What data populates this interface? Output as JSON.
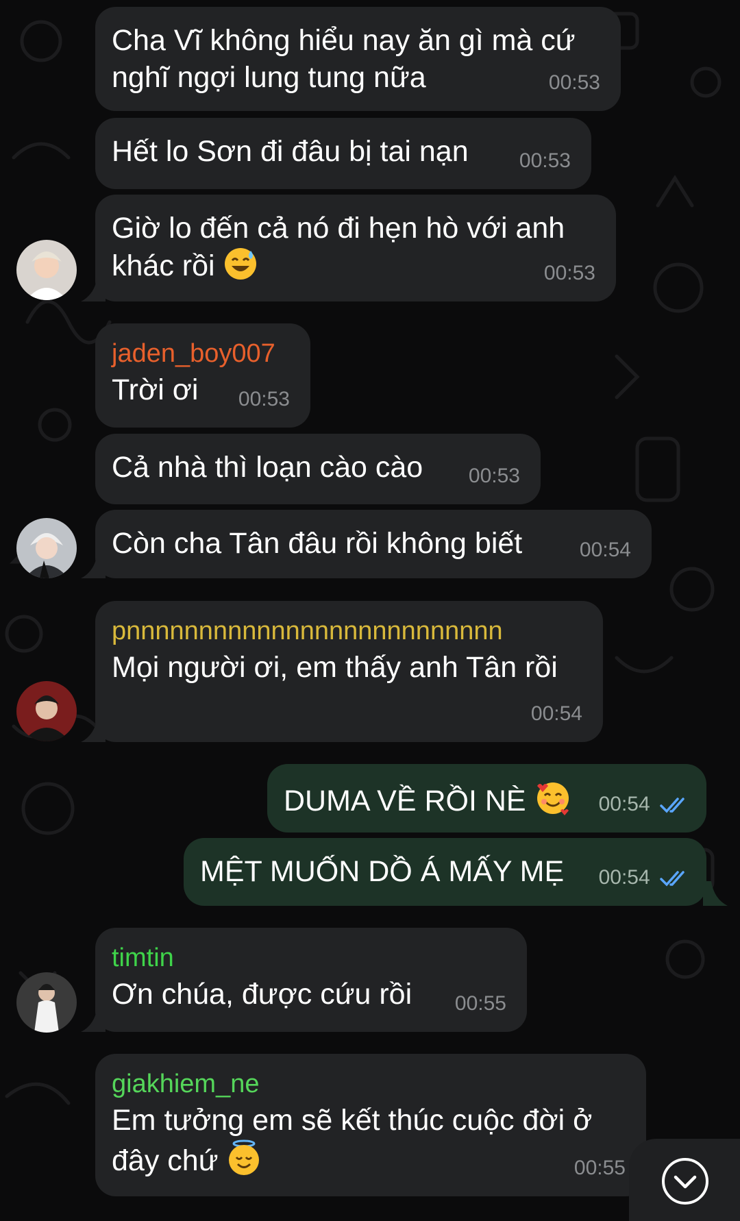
{
  "messages": [
    {
      "id": "m1",
      "direction": "incoming",
      "sender": "",
      "text": "Cha Vĩ không hiểu nay ăn gì mà cứ\nnghĩ ngợi lung tung nữa",
      "time": "00:53"
    },
    {
      "id": "m2",
      "direction": "incoming",
      "sender": "",
      "text": "Hết lo Sơn đi đâu bị tai nạn",
      "time": "00:53"
    },
    {
      "id": "m3",
      "direction": "incoming",
      "sender": "",
      "text": "Giờ lo đến cả nó đi hẹn hò với anh\nkhác rồi",
      "emoji": "sweat-smile-emoji",
      "time": "00:53"
    },
    {
      "id": "m4",
      "direction": "incoming",
      "sender": "jaden_boy007",
      "sender_color": "#e8602c",
      "text": "Trời ơi",
      "time": "00:53"
    },
    {
      "id": "m5",
      "direction": "incoming",
      "sender": "",
      "text": "Cả nhà thì loạn cào cào",
      "time": "00:53"
    },
    {
      "id": "m6",
      "direction": "incoming",
      "sender": "",
      "text": "Còn cha Tân đâu rồi không biết",
      "time": "00:54"
    },
    {
      "id": "m7",
      "direction": "incoming",
      "sender": "pnnnnnnnnnnnnnnnnnnnnnnnnnn",
      "sender_color": "#d9b93b",
      "text": "Mọi người ơi, em thấy anh Tân rồi",
      "time": "00:54"
    },
    {
      "id": "m8",
      "direction": "outgoing",
      "sender": "",
      "text": "DUMA VỀ RỒI NÈ",
      "emoji": "smiling-face-with-hearts-emoji",
      "time": "00:54",
      "status": "read"
    },
    {
      "id": "m9",
      "direction": "outgoing",
      "sender": "",
      "text": "MỆT MUỐN DỒ Á MẤY MẸ",
      "time": "00:54",
      "status": "read"
    },
    {
      "id": "m10",
      "direction": "incoming",
      "sender": "timtin",
      "sender_color": "#3fd44a",
      "text": "Ơn chúa, được cứu rồi",
      "time": "00:55"
    },
    {
      "id": "m11",
      "direction": "incoming",
      "sender": "giakhiem_ne",
      "sender_color": "#55d65a",
      "text": "Em tưởng em sẽ kết thúc cuộc đời ở\nđây chứ",
      "emoji": "smiling-face-with-halo-emoji",
      "time": "00:55"
    }
  ],
  "colors": {
    "background": "#0b0b0c",
    "incoming_bubble": "#222325",
    "outgoing_bubble": "#1d3327",
    "read_ticks": "#5aa6ff"
  },
  "icons": {
    "scroll_down": "chevron-down-icon",
    "read_status": "double-check-icon"
  }
}
